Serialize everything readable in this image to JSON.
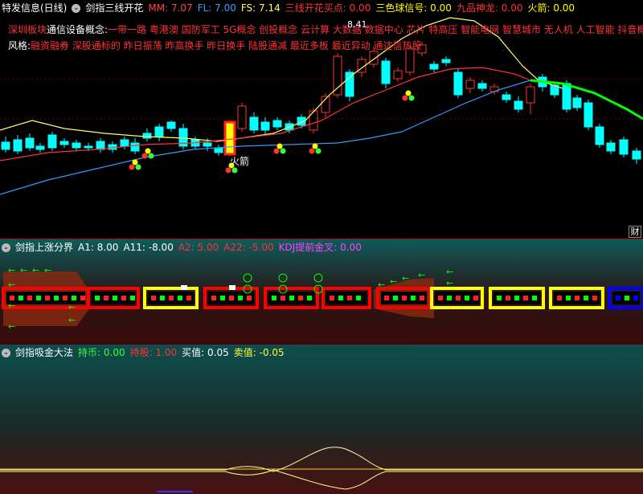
{
  "pane1": {
    "header": {
      "stock_title": "特发信息(日线)",
      "indicator_name": "剑指三线开花",
      "mm": "MM: 7.07",
      "fl": "FL: 7.00",
      "fs": "FS: 7.14",
      "sanxian": "三线开花买点: 0.00",
      "sanse": "三色球信号: 0.00",
      "jiupin": "九品神龙: 0.00",
      "huojian": "火箭: 0.00"
    },
    "line1_prefix": "深圳板块",
    "line1_overlap": "通信设备",
    "line1_concept": "概念:",
    "line1_rest": "一带一路 粤港澳 国防军工 5G概念 创投概念 云计算 大数据 数据中心 芯片 特高压 智能电网 智慧城市 无人机 人工智能 抖音概念",
    "line2_prefix": "风格:",
    "line2_rest": "融资融券 深股通标的 昨日振荡 昨高换手 昨日换手 陆股通减 最近多板 最近异动 通达信热股",
    "price_label": "8.41",
    "rocket_label": "火箭",
    "cai_label": "财"
  },
  "pane2": {
    "header": {
      "name": "剑指上涨分界",
      "a1": "A1: 8.00",
      "a11": "A11: -8.00",
      "a2": "A2: 5.00",
      "a22": "A22: -5.00",
      "kdj": "KDJ提前金叉: 0.00"
    }
  },
  "pane3": {
    "header": {
      "name": "剑指吸金大法",
      "chibi": "持币: 0.00",
      "chigu": "持股: 1.00",
      "mai": "买值: 0.05",
      "mai2": "卖值: -0.05"
    }
  },
  "colors": {
    "up": "#ff3333",
    "down": "#00ffff",
    "mm": "#ff3333",
    "fl": "#3399ff",
    "fs": "#ffff66",
    "green": "#00ff00"
  }
}
